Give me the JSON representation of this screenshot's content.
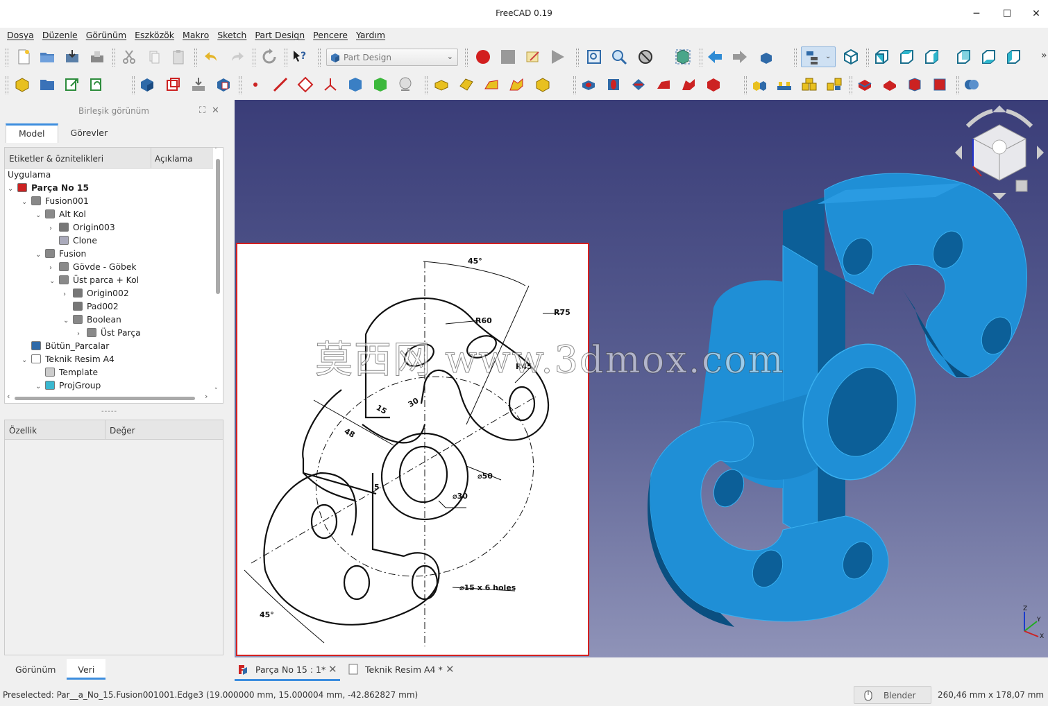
{
  "window": {
    "title": "FreeCAD 0.19",
    "minimize": "─",
    "maximize": "☐",
    "close": "✕"
  },
  "menu": [
    "Dosya",
    "Düzenle",
    "Görünüm",
    "Eszközök",
    "Makro",
    "Sketch",
    "Part Design",
    "Pencere",
    "Yardım"
  ],
  "workbench": {
    "selected": "Part Design"
  },
  "combo_view": {
    "title": "Birleşik görünüm",
    "tabs": [
      "Model",
      "Görevler"
    ],
    "tree_columns": [
      "Etiketler & öznitelikleri",
      "Açıklama"
    ],
    "tree_root": "Uygulama",
    "tree": [
      {
        "label": "Parça No 15",
        "bold": true,
        "arrow": "⌄",
        "icon": "part"
      },
      {
        "label": "Fusion001",
        "arrow": "⌄",
        "icon": "bool"
      },
      {
        "label": "Alt Kol",
        "arrow": "⌄",
        "icon": "body"
      },
      {
        "label": "Origin003",
        "arrow": "›",
        "icon": "origin"
      },
      {
        "label": "Clone",
        "arrow": "",
        "icon": "clone"
      },
      {
        "label": "Fusion",
        "arrow": "⌄",
        "icon": "bool"
      },
      {
        "label": "Gövde - Göbek",
        "arrow": "›",
        "icon": "body"
      },
      {
        "label": "Üst parca + Kol",
        "arrow": "⌄",
        "icon": "body"
      },
      {
        "label": "Origin002",
        "arrow": "›",
        "icon": "origin"
      },
      {
        "label": "Pad002",
        "arrow": "",
        "icon": "pad"
      },
      {
        "label": "Boolean",
        "arrow": "⌄",
        "icon": "bool"
      },
      {
        "label": "Üst Parça",
        "arrow": "›",
        "icon": "body"
      },
      {
        "label": "Bütün_Parcalar",
        "arrow": "",
        "icon": "compound"
      },
      {
        "label": "Teknik Resim A4",
        "arrow": "⌄",
        "icon": "page"
      },
      {
        "label": "Template",
        "arrow": "",
        "icon": "template"
      },
      {
        "label": "ProjGroup",
        "arrow": "⌄",
        "icon": "projgroup"
      }
    ],
    "splitter": "-----",
    "property_columns": [
      "Özellik",
      "Değer"
    ],
    "bottom_tabs": [
      "Görünüm",
      "Veri"
    ]
  },
  "drawing_labels": {
    "angle_top": "45°",
    "r75": "R75",
    "r60": "R60",
    "r45": "R45",
    "d15": "15",
    "d30": "30",
    "d48": "48",
    "d5": "5",
    "dia50": "⌀50",
    "dia30": "⌀30",
    "holes": "⌀15 x 6 holes",
    "angle_bottom": "45°"
  },
  "watermark": "莫西网 www.3dmox.com",
  "doc_tabs": [
    {
      "label": "Parça No 15 : 1*",
      "active": true
    },
    {
      "label": "Teknik Resim A4 *",
      "active": false
    }
  ],
  "status": {
    "message": "Preselected: Par__a_No_15.Fusion001001.Edge3 (19.000000 mm, 15.000004 mm, -42.862827 mm)",
    "nav_style": "Blender",
    "dimensions": "260,46 mm x 178,07 mm"
  },
  "colors": {
    "part_blue": "#1f8fd6",
    "part_dark": "#0c5f98",
    "accent": "#3c8dde",
    "drawing_border": "#d42020"
  }
}
